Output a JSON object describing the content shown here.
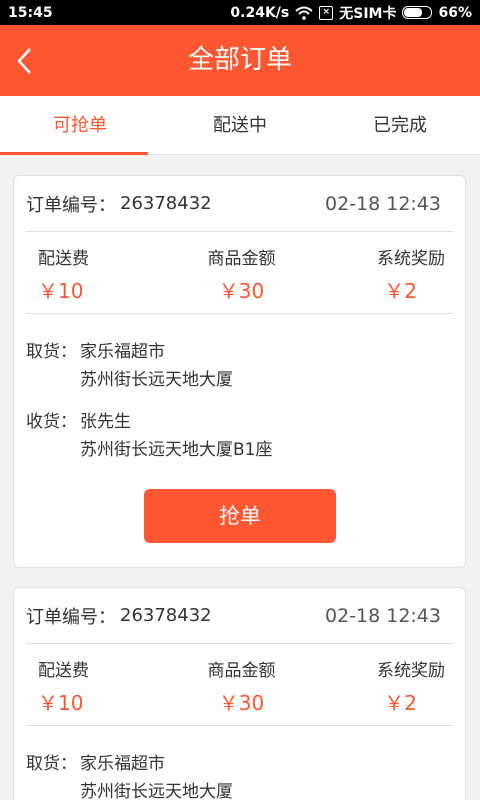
{
  "status": {
    "time": "15:45",
    "speed": "0.24K/s",
    "sim": "无SIM卡",
    "battery": "66%",
    "battery_level": 0.66
  },
  "header": {
    "title": "全部订单"
  },
  "tabs": [
    {
      "label": "可抢单"
    },
    {
      "label": "配送中"
    },
    {
      "label": "已完成"
    }
  ],
  "orders": [
    {
      "label": "订单编号：",
      "number": "26378432",
      "time": "02-18 12:43",
      "fees": [
        {
          "label": "配送费",
          "value": "￥10"
        },
        {
          "label": "商品金额",
          "value": "￥30"
        },
        {
          "label": "系统奖励",
          "value": "￥2"
        }
      ],
      "pickup_label": "取货：",
      "pickup_name": "家乐福超市",
      "pickup_addr": "苏州街长远天地大厦",
      "receive_label": "收货：",
      "receive_name": "张先生",
      "receive_addr": "苏州街长远天地大厦B1座",
      "button": "抢单"
    },
    {
      "label": "订单编号：",
      "number": "26378432",
      "time": "02-18 12:43",
      "fees": [
        {
          "label": "配送费",
          "value": "￥10"
        },
        {
          "label": "商品金额",
          "value": "￥30"
        },
        {
          "label": "系统奖励",
          "value": "￥2"
        }
      ],
      "pickup_label": "取货：",
      "pickup_name": "家乐福超市",
      "pickup_addr": "苏州街长远天地大厦"
    }
  ],
  "colors": {
    "accent": "#fe5630",
    "background": "#f2f2f5"
  },
  "icons": {
    "back": "chevron-left-icon",
    "wifi": "wifi-icon",
    "sim": "sim-icon",
    "battery": "battery-icon"
  }
}
